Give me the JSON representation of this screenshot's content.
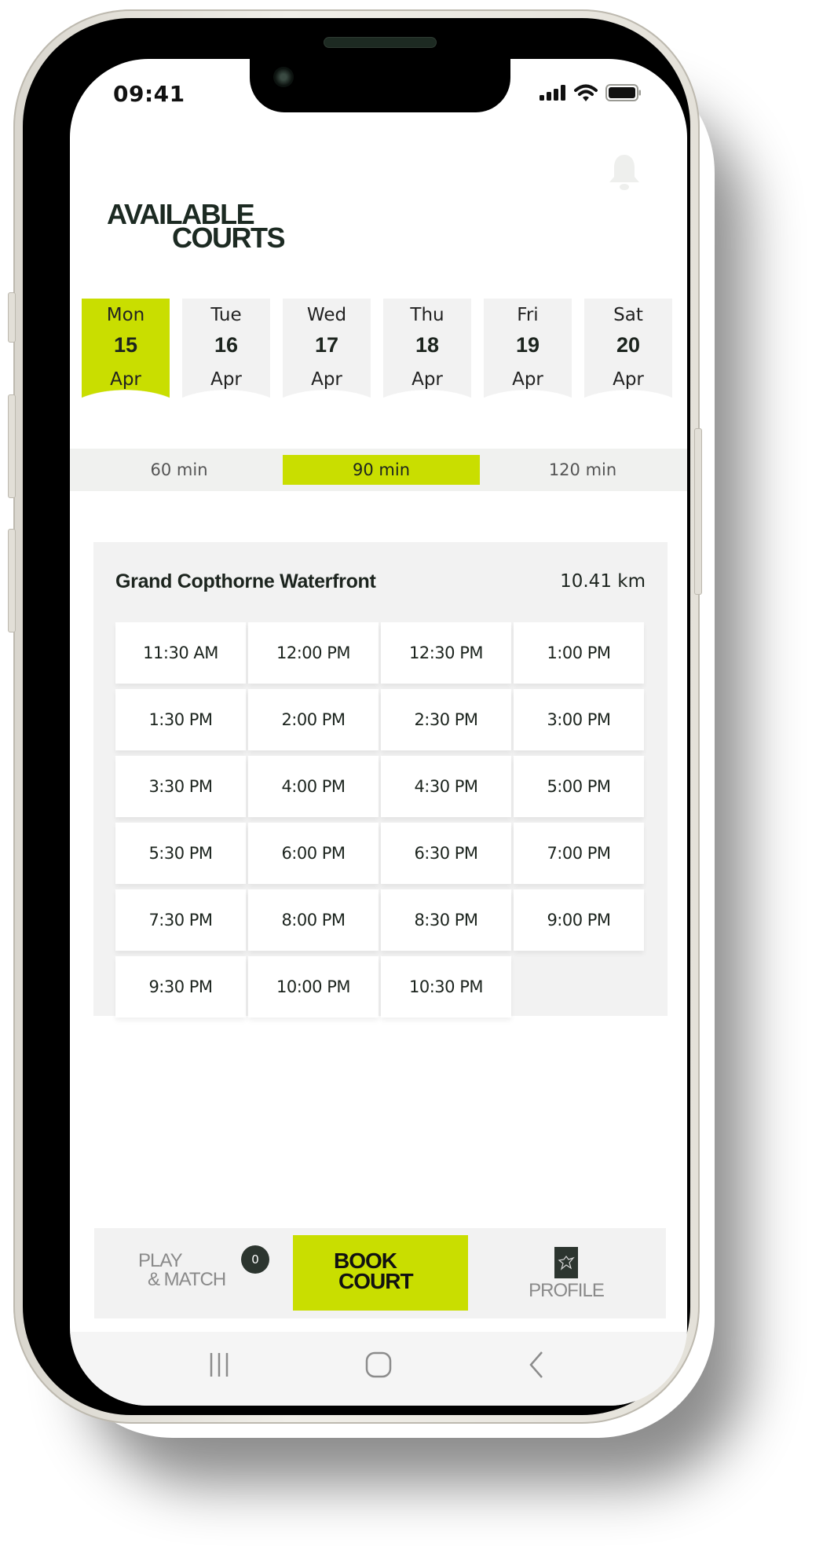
{
  "status_bar": {
    "time": "09:41",
    "icons": [
      "signal-icon",
      "wifi-icon",
      "battery-icon"
    ]
  },
  "header": {
    "title_line1": "AVAILABLE",
    "title_line2": "COURTS",
    "bell_icon": "bell-icon"
  },
  "days": [
    {
      "weekday": "Mon",
      "date": "15",
      "month": "Apr",
      "selected": true
    },
    {
      "weekday": "Tue",
      "date": "16",
      "month": "Apr",
      "selected": false
    },
    {
      "weekday": "Wed",
      "date": "17",
      "month": "Apr",
      "selected": false
    },
    {
      "weekday": "Thu",
      "date": "18",
      "month": "Apr",
      "selected": false
    },
    {
      "weekday": "Fri",
      "date": "19",
      "month": "Apr",
      "selected": false
    },
    {
      "weekday": "Sat",
      "date": "20",
      "month": "Apr",
      "selected": false
    }
  ],
  "durations": [
    {
      "label": "60 min",
      "selected": false
    },
    {
      "label": "90 min",
      "selected": true
    },
    {
      "label": "120 min",
      "selected": false
    }
  ],
  "venue": {
    "name": "Grand Copthorne Waterfront",
    "distance": "10.41 km",
    "slots": [
      "11:30 AM",
      "12:00 PM",
      "12:30 PM",
      "1:00 PM",
      "1:30 PM",
      "2:00 PM",
      "2:30 PM",
      "3:00 PM",
      "3:30 PM",
      "4:00 PM",
      "4:30 PM",
      "5:00 PM",
      "5:30 PM",
      "6:00 PM",
      "6:30 PM",
      "7:00 PM",
      "7:30 PM",
      "8:00 PM",
      "8:30 PM",
      "9:00 PM",
      "9:30 PM",
      "10:00 PM",
      "10:30 PM"
    ]
  },
  "bottom_nav": {
    "play_line1": "PLAY",
    "play_line2": "& MATCH",
    "play_badge": "0",
    "book_line1": "BOOK",
    "book_line2": "COURT",
    "profile_label": "PROFILE"
  },
  "system_nav": {
    "recents": "recents-icon",
    "home": "home-icon",
    "back": "back-icon"
  },
  "colors": {
    "accent": "#c9de00",
    "dark": "#1c241e",
    "surface": "#f2f2f2"
  }
}
